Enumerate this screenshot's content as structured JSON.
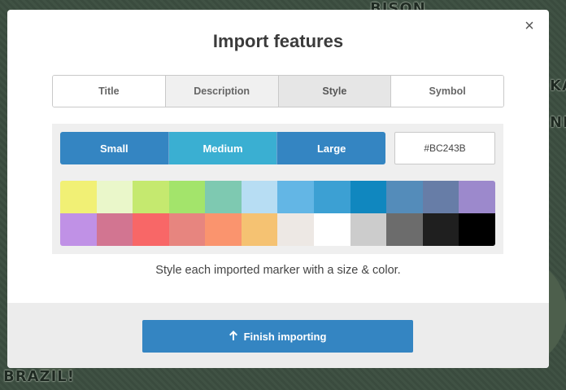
{
  "background": {
    "labels": [
      "BRAZIL!",
      "KAZ",
      "NEK",
      "BISON"
    ]
  },
  "modal": {
    "title": "Import features",
    "close_glyph": "×",
    "tabs": [
      {
        "label": "Title"
      },
      {
        "label": "Description"
      },
      {
        "label": "Style",
        "active": true
      },
      {
        "label": "Symbol"
      }
    ],
    "sizes": [
      {
        "label": "Small"
      },
      {
        "label": "Medium",
        "active": true
      },
      {
        "label": "Large"
      }
    ],
    "color_value": "#BC243B",
    "swatches": [
      "#f1f075",
      "#eaf7ca",
      "#c5e96f",
      "#a3e46b",
      "#7ec9b1",
      "#b7ddf3",
      "#63b6e5",
      "#3ca0d3",
      "#1087bf",
      "#548cba",
      "#677da7",
      "#9c89cc",
      "#c091e6",
      "#d27591",
      "#f86767",
      "#e7857f",
      "#fa946e",
      "#f5c272",
      "#ede8e4",
      "#ffffff",
      "#cccccc",
      "#6c6c6c",
      "#1f1f1f",
      "#000000"
    ],
    "hint": "Style each imported marker with a size & color.",
    "finish_label": "Finish importing",
    "finish_icon": "arrow-up-icon"
  },
  "colors": {
    "primary": "#3485c2",
    "active_size": "#3aafd2"
  }
}
